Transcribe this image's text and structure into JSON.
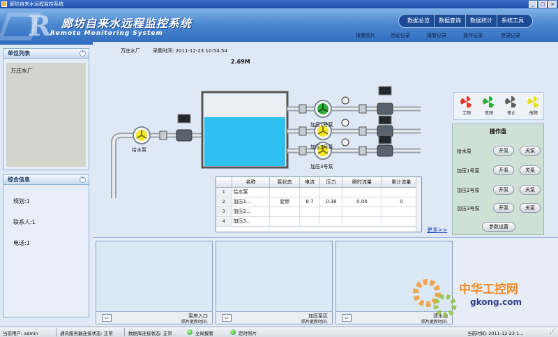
{
  "window": {
    "title": "廊坊自来水远程监控系统"
  },
  "header": {
    "app_title": "廊坊自来水远程监控系统",
    "subtitle": "Remote Monitoring System",
    "nav": [
      "数据总览",
      "数据查询",
      "数据统计",
      "系统工具"
    ],
    "subnav": [
      "报警图片",
      "历史记录",
      "报警记录",
      "操作记录",
      "登录记录"
    ]
  },
  "unit_list": {
    "title": "单位列表",
    "items": [
      "万庄水厂"
    ]
  },
  "info_panel": {
    "title": "综合信息",
    "lines": [
      "规划:1",
      "联系人:1",
      "电话:1"
    ]
  },
  "main": {
    "station": "万庄水厂",
    "time_label": "采集时间: 2011-12-23 10:54:54",
    "tank_level": "2.69M",
    "inlet_pump_label": "给水泵",
    "booster_labels": [
      "加压1号泵",
      "加压2号泵",
      "加压3号泵"
    ]
  },
  "table": {
    "headers": [
      "",
      "名称",
      "泵状态",
      "电流",
      "压力",
      "瞬时流量",
      "累计流量"
    ],
    "rows": [
      [
        "1",
        "给水泵",
        "",
        "",
        "",
        "",
        ""
      ],
      [
        "2",
        "加压1...",
        "变频",
        "8.7",
        "0.38",
        "0.00",
        "0"
      ],
      [
        "3",
        "加压2...",
        "",
        "",
        "",
        "",
        ""
      ],
      [
        "4",
        "加压3...",
        "",
        "",
        "",
        "",
        ""
      ]
    ],
    "more": "更多>>"
  },
  "legend": {
    "items": [
      {
        "label": "工频",
        "color": "#e23a2a"
      },
      {
        "label": "变频",
        "color": "#2fae3c"
      },
      {
        "label": "停止",
        "color": "#606060"
      },
      {
        "label": "故障",
        "color": "#e8e21e"
      }
    ]
  },
  "control": {
    "title": "操作盘",
    "rows": [
      {
        "label": "给水泵",
        "on": "开泵",
        "off": "关泵"
      },
      {
        "label": "加压1号泵",
        "on": "开泵",
        "off": "关泵"
      },
      {
        "label": "加压2号泵",
        "on": "开泵",
        "off": "关泵"
      },
      {
        "label": "加压3号泵",
        "on": "开泵",
        "off": "关泵"
      }
    ],
    "settings": "参数设置"
  },
  "cameras": [
    {
      "name": "泵房入口",
      "time": "照片更新时间:"
    },
    {
      "name": "加压泵区",
      "time": "照片更新时间:"
    },
    {
      "name": "清水池",
      "time": "照片更新时间:"
    }
  ],
  "status": {
    "user": "当前用户: admin",
    "link": "通讯服务器连接状态: 正常",
    "db": "数据库连接状态: 正常",
    "alarm": "全局报警",
    "photo": "定时照片",
    "clock": "当前时间: 2011-12-23 1..."
  },
  "watermark": {
    "cn": "中华工控网",
    "en": "gkong.com"
  }
}
